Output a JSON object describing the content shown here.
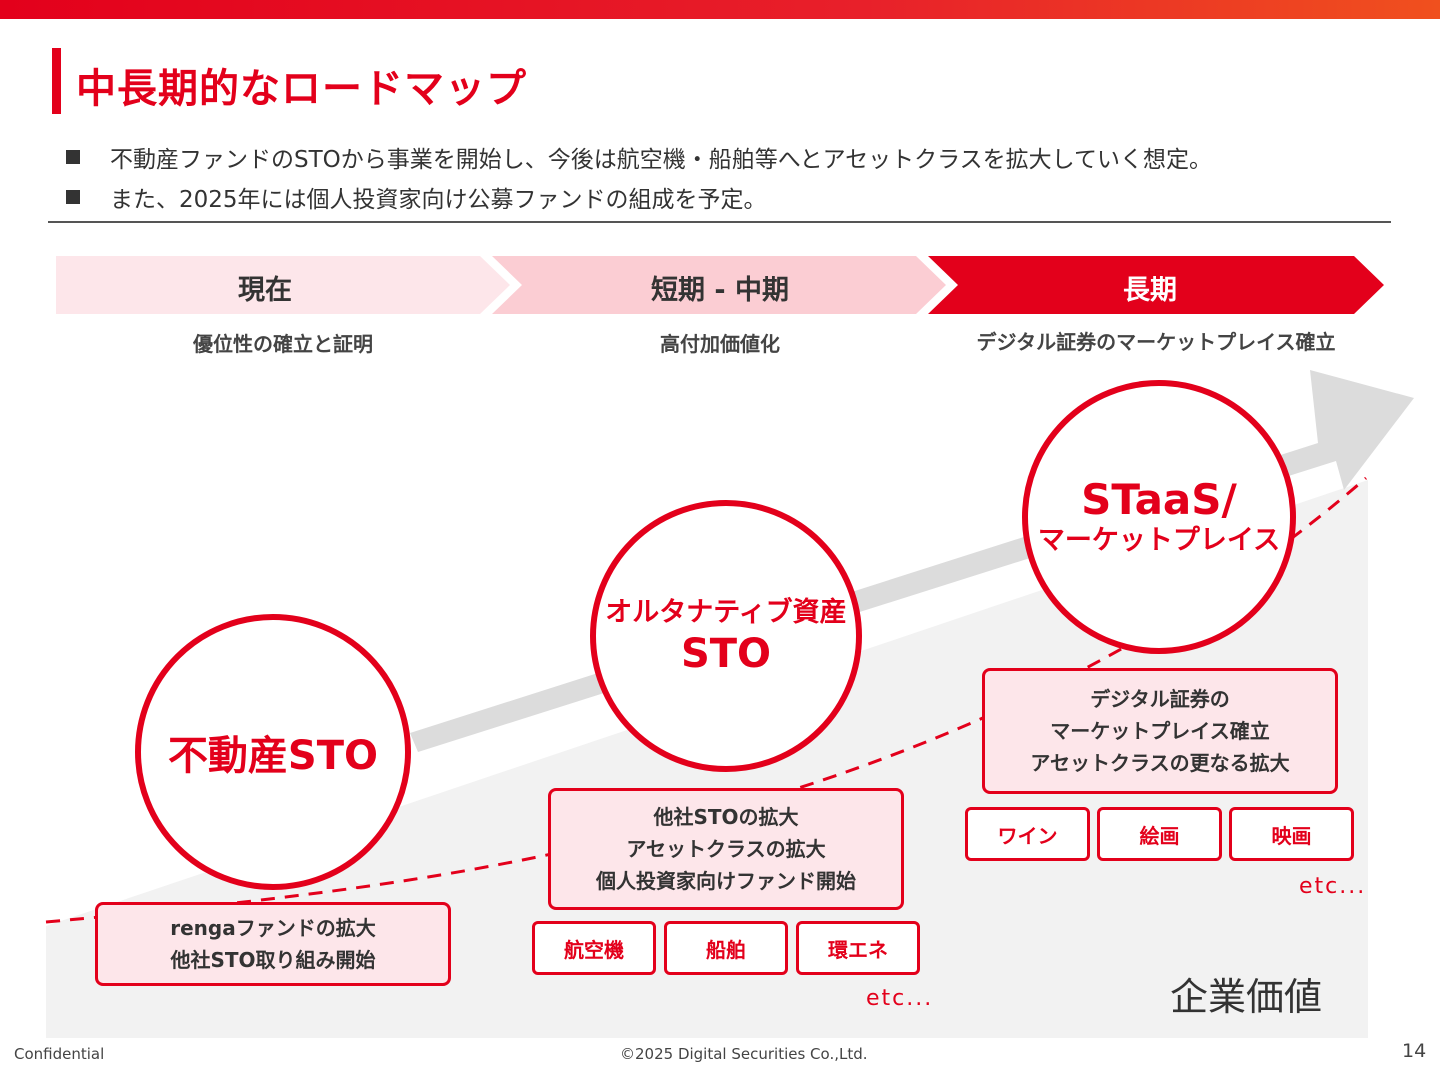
{
  "title": "中長期的なロードマップ",
  "bullets": [
    "不動産ファンドのSTOから事業を開始し、今後は航空機・船舶等へとアセットクラスを拡大していく想定。",
    "また、2025年には個人投資家向け公募ファンドの組成を予定。"
  ],
  "phases": [
    {
      "label": "現在",
      "sub": "優位性の確立と証明"
    },
    {
      "label": "短期 - 中期",
      "sub": "高付加価値化"
    },
    {
      "label": "長期",
      "sub": "デジタル証券のマーケットプレイス確立"
    }
  ],
  "stages": [
    {
      "circle": [
        "不動産STO"
      ],
      "box": [
        "rengaファンドの拡大",
        "他社STO取り組み開始"
      ],
      "tags": []
    },
    {
      "circle": [
        "オルタナティブ資産",
        "STO"
      ],
      "box": [
        "他社STOの拡大",
        "アセットクラスの拡大",
        "個人投資家向けファンド開始"
      ],
      "tags": [
        "航空機",
        "船舶",
        "環エネ"
      ],
      "etc": "etc..."
    },
    {
      "circle": [
        "STaaS/",
        "マーケットプレイス"
      ],
      "box": [
        "デジタル証券の",
        "マーケットプレイス確立",
        "アセットクラスの更なる拡大"
      ],
      "tags": [
        "ワイン",
        "絵画",
        "映画"
      ],
      "etc": "etc..."
    }
  ],
  "value_label": "企業価値",
  "footer": {
    "left": "Confidential",
    "center": "©2025 Digital Securities Co.,Ltd.",
    "page": "14"
  },
  "colors": {
    "accent": "#e3001b",
    "chevron_light": "#fde6ea",
    "chevron_mid": "#fbcdd3",
    "box_fill": "#fde6ea",
    "area": "#f2f2f2",
    "arrow": "#dcdcdc"
  }
}
